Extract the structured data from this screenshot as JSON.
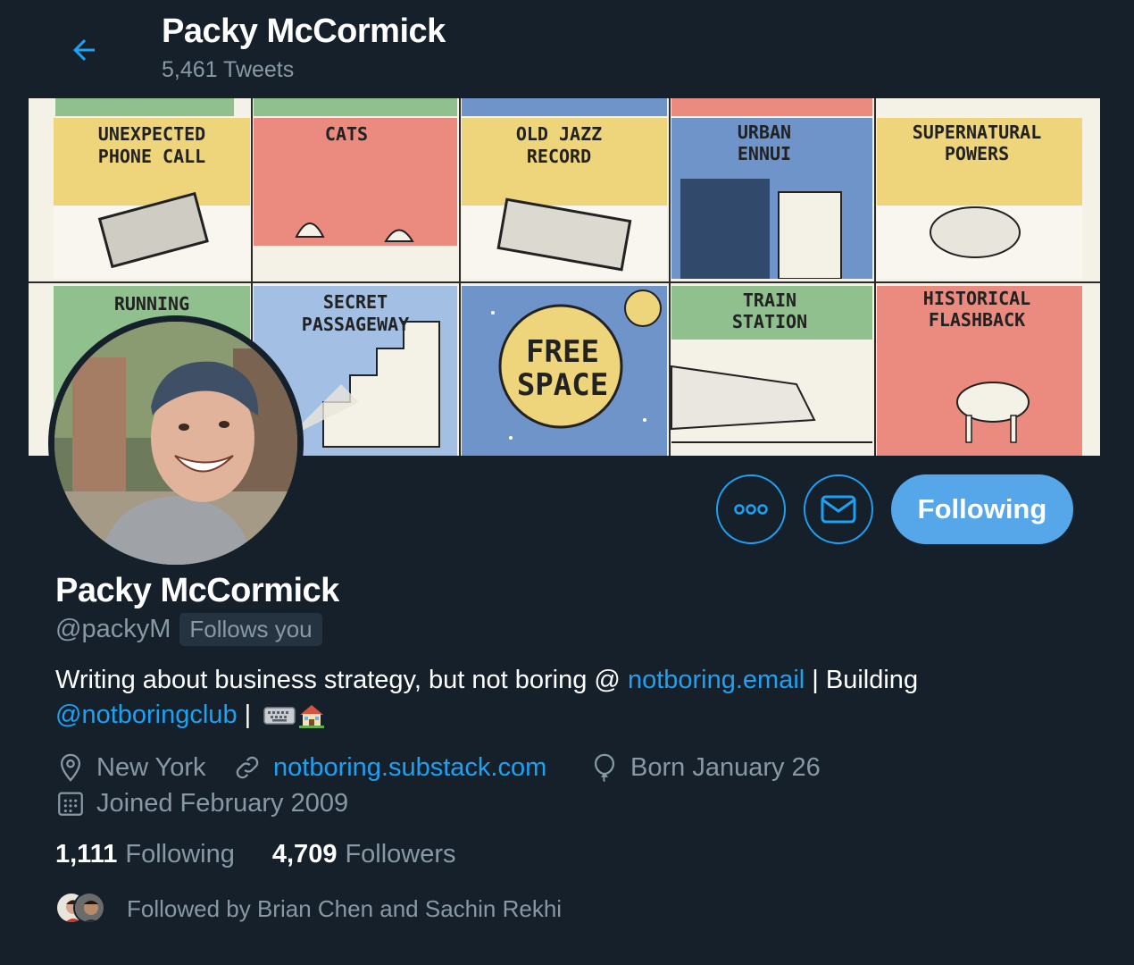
{
  "header": {
    "title": "Packy McCormick",
    "tweet_count": "5,461 Tweets"
  },
  "banner": {
    "panels": [
      "UNEXPECTED PHONE CALL",
      "CATS",
      "OLD JAZZ RECORD",
      "URBAN ENNUI",
      "SUPERNATURAL POWERS",
      "RUNNING",
      "SECRET PASSAGEWAY",
      "FREE SPACE",
      "TRAIN STATION",
      "HISTORICAL FLASHBACK"
    ],
    "row1": [
      {
        "line1": "UNEXPECTED",
        "line2": "PHONE CALL"
      },
      {
        "line1": "CATS",
        "line2": ""
      },
      {
        "line1": "OLD JAZZ",
        "line2": "RECORD"
      },
      {
        "line1": "URBAN",
        "line2": "ENNUI"
      },
      {
        "line1": "SUPERNATURAL",
        "line2": "POWERS"
      }
    ],
    "row2": [
      {
        "line1": "RUNNING",
        "line2": ""
      },
      {
        "line1": "SECRET",
        "line2": "PASSAGEWAY"
      },
      {
        "line1": "FREE",
        "line2": "SPACE"
      },
      {
        "line1": "TRAIN",
        "line2": "STATION"
      },
      {
        "line1": "HISTORICAL",
        "line2": "FLASHBACK"
      }
    ]
  },
  "actions": {
    "more_icon": "more-icon",
    "message_icon": "envelope-icon",
    "following_label": "Following"
  },
  "profile": {
    "name": "Packy McCormick",
    "handle": "@packyM",
    "follows_you": "Follows you"
  },
  "bio": {
    "text1": "Writing about business strategy, but not boring @ ",
    "link1": "notboring.email",
    "text2": " | Building ",
    "link2": "@notboringclub",
    "text3": " | "
  },
  "meta": {
    "location": "New York",
    "website": "notboring.substack.com",
    "birthday": "Born January 26",
    "joined": "Joined February 2009"
  },
  "stats": {
    "following_count": "1,111",
    "following_label": "Following",
    "followers_count": "4,709",
    "followers_label": "Followers"
  },
  "followed_by": {
    "text": "Followed by Brian Chen and Sachin Rekhi"
  },
  "colors": {
    "background": "#15202b",
    "accent": "#1da1f2",
    "muted": "#8899a6",
    "following_button": "#55a7ea"
  }
}
